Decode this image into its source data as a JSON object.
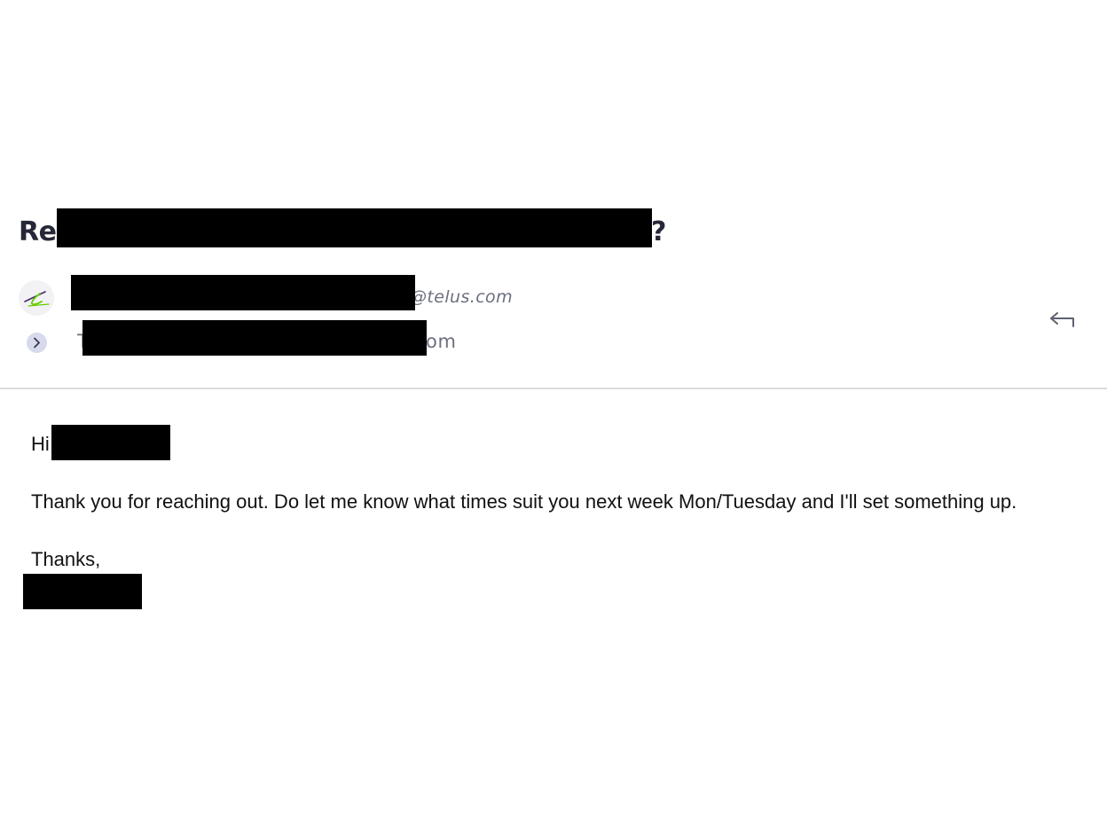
{
  "email": {
    "subject_prefix": "Re:",
    "subject_suffix": "?",
    "sender_email_visible": "@telus.com",
    "recipient_prefix_visible": "T",
    "recipient_email_visible": "om"
  },
  "body": {
    "greeting": "Hi",
    "message": "Thank you for reaching out. Do let me know what times suit you next week Mon/Tuesday and I'll set something up.",
    "signoff": "Thanks,"
  },
  "icons": {
    "avatar": "telus-logo-icon",
    "expand": "chevron-right-icon",
    "reply": "reply-arrow-icon"
  },
  "colors": {
    "title": "#262838",
    "meta_text": "#6c6f80",
    "expand_bg": "#d7d9ec",
    "redaction": "#000000"
  }
}
